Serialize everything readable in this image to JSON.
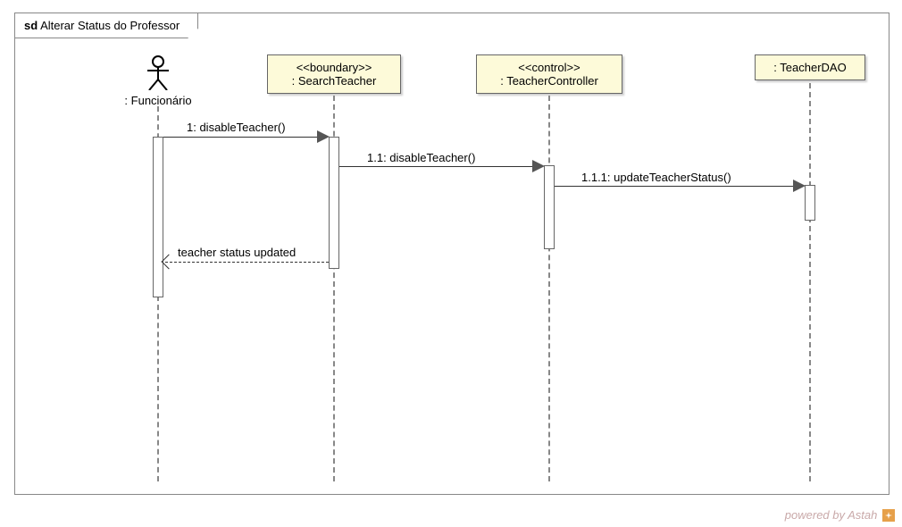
{
  "frame": {
    "sd_prefix": "sd",
    "title": "Alterar Status do Professor"
  },
  "participants": {
    "actor": {
      "label": ": Funcionário"
    },
    "boundary": {
      "stereotype": "<<boundary>>",
      "name": ": SearchTeacher"
    },
    "control": {
      "stereotype": "<<control>>",
      "name": ": TeacherController"
    },
    "dao": {
      "name": ": TeacherDAO"
    }
  },
  "messages": {
    "m1": "1: disableTeacher()",
    "m2": "1.1: disableTeacher()",
    "m3": "1.1.1: updateTeacherStatus()",
    "ret": "teacher status updated"
  },
  "watermark": "powered by Astah"
}
